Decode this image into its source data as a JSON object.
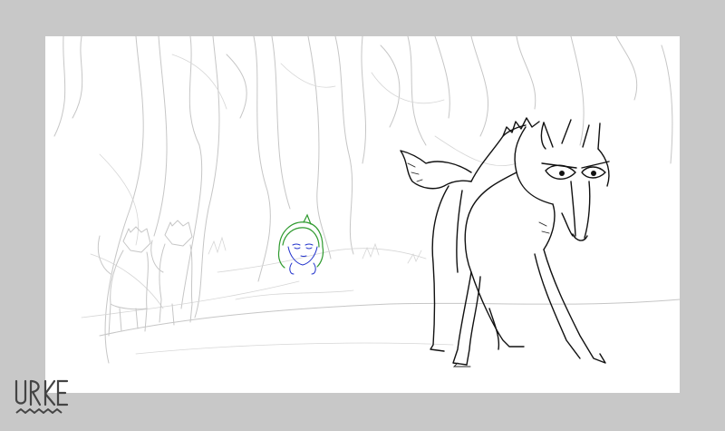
{
  "window": {
    "background": "#c8c8c8",
    "canvas_color": "#ffffff"
  },
  "scene": {
    "elements": [
      "forest-trees-sketch",
      "background-wolves-sketch",
      "girl-head-drawing",
      "foreground-wolf-lineart"
    ],
    "colors": {
      "sketch_lines": "#c6c6c6",
      "wolf_lines": "#111111",
      "girl_hair": "#2f9a2f",
      "girl_face": "#2233cc"
    }
  },
  "logo": {
    "text": "URKE",
    "icon": "zigzag-underline-icon"
  }
}
